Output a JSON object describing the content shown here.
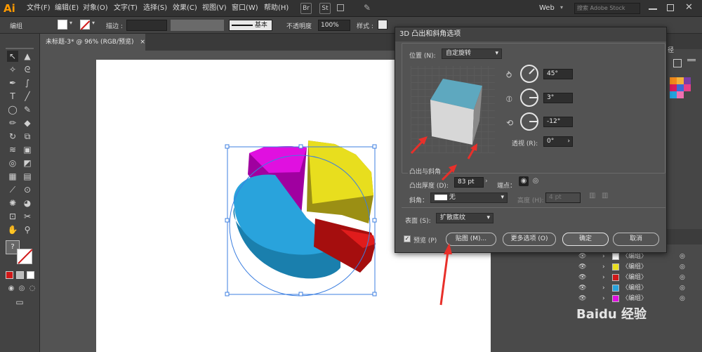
{
  "app": {
    "logo": "Ai"
  },
  "menubar": {
    "items": [
      "文件(F)",
      "编辑(E)",
      "对象(O)",
      "文字(T)",
      "选择(S)",
      "效果(C)",
      "视图(V)",
      "窗口(W)",
      "帮助(H)"
    ],
    "br_label": "Br",
    "st_label": "St",
    "workspace": "Web",
    "search_placeholder": "搜索 Adobe Stock"
  },
  "control": {
    "selection_type": "编组",
    "stroke_label": "描边 :",
    "stroke_style": "基本",
    "opacity_label": "不透明度",
    "opacity_value": "100%",
    "style_label": "样式 :"
  },
  "document": {
    "tab_title": "未标题-3* @ 96% (RGB/预览)",
    "close_glyph": "×"
  },
  "right_panel": {
    "partial_tab": "径",
    "layers": [
      {
        "name": "〈编组〉",
        "color": "#ffffff"
      },
      {
        "name": "〈编组〉",
        "color": "#e8de1e"
      },
      {
        "name": "〈编组〉",
        "color": "#d01818"
      },
      {
        "name": "〈编组〉",
        "color": "#29a3dc"
      },
      {
        "name": "〈编组〉",
        "color": "#e010e0"
      }
    ],
    "swatch_colors": [
      "#f28a1c",
      "#f4b23a",
      "#7a3ea6",
      "#d91a5e",
      "#3b6bd6",
      "#e63f8a",
      "#23a3dc",
      "#f06fb0"
    ],
    "watermark": "Baidu 经验"
  },
  "dialog": {
    "title": "3D 凸出和斜角选项",
    "position_label": "位置 (N):",
    "position_value": "自定旋转",
    "rot_x": "45°",
    "rot_y": "3°",
    "rot_z": "-12°",
    "perspective_label": "透视 (R):",
    "perspective_value": "0°",
    "extrude_section": "凸出与斜角",
    "extrude_depth_label": "凸出厚度 (D):",
    "extrude_depth_value": "83 pt",
    "cap_label": "端点：",
    "bevel_label": "斜角：",
    "bevel_value": "无",
    "height_label": "高度 (H):",
    "height_value": "4 pt",
    "surface_label": "表面 (S):",
    "surface_value": "扩散底纹",
    "preview_label": "预览 (P)",
    "map_button": "贴图 (M)...",
    "more_button": "更多选项 (O)",
    "ok_button": "确定",
    "cancel_button": "取消"
  },
  "colors": {
    "cyan": "#29a3dc",
    "yellow": "#e8de1e",
    "red": "#d01818",
    "magenta": "#e010e0",
    "arrow": "#e8302a"
  }
}
